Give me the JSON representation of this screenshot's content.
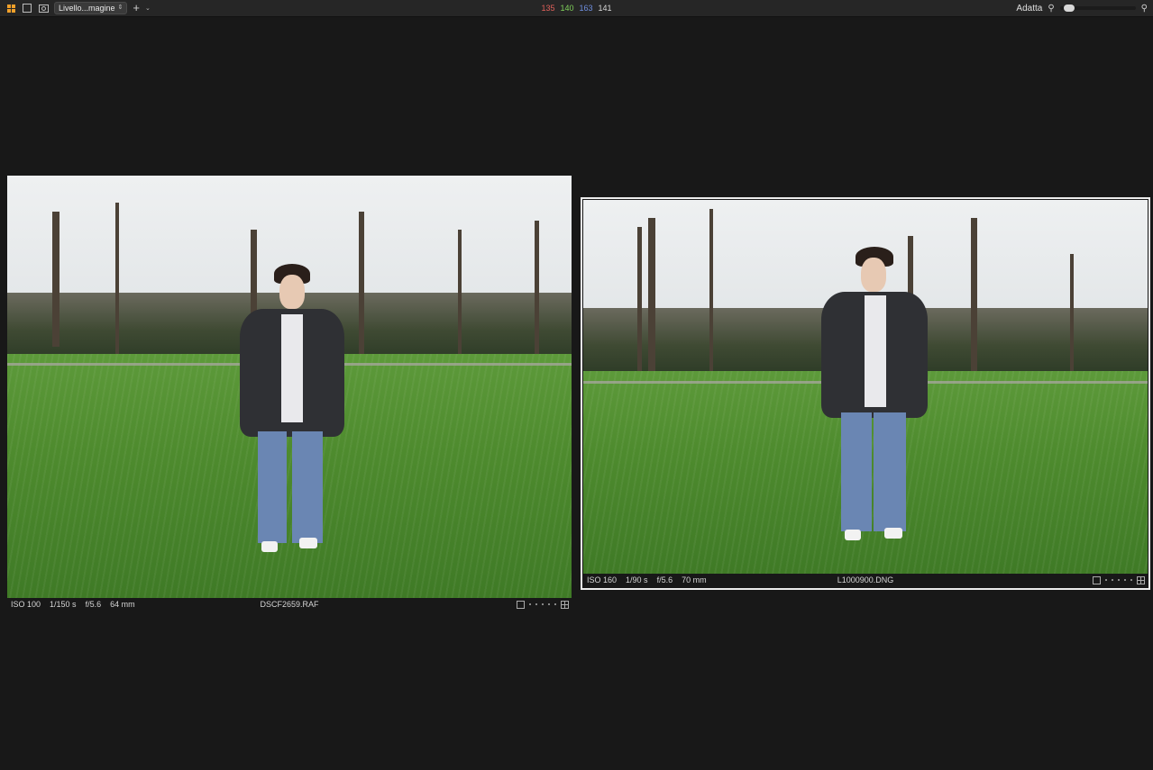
{
  "toolbar": {
    "layer_select": "Livello...magine",
    "add_label": "+",
    "pixel_values": {
      "r": "135",
      "g": "140",
      "b": "163",
      "l": "141"
    },
    "zoom_label": "Adatta",
    "zoom_level": 0.05
  },
  "viewer": {
    "images": [
      {
        "iso": "ISO 100",
        "shutter": "1/150 s",
        "aperture": "f/5.6",
        "focal": "64 mm",
        "filename": "DSCF2659.RAF",
        "selected": false
      },
      {
        "iso": "ISO 160",
        "shutter": "1/90 s",
        "aperture": "f/5.6",
        "focal": "70 mm",
        "filename": "L1000900.DNG",
        "selected": true
      }
    ]
  },
  "colors": {
    "accent": "#f0a02a",
    "background": "#181818",
    "toolbar": "#262626"
  }
}
